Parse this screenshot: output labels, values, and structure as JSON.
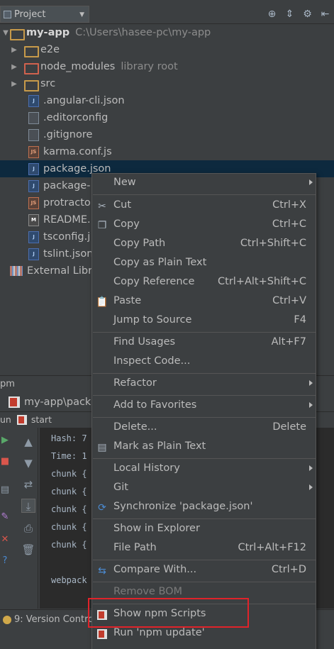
{
  "project_bar": {
    "selector_label": "Project",
    "toolbar_icons": [
      "target-icon",
      "collapse-icon",
      "gear-icon",
      "hide-icon"
    ]
  },
  "tree": {
    "root": {
      "name": "my-app",
      "path": "C:\\Users\\hasee-pc\\my-app"
    },
    "items": [
      {
        "name": "e2e",
        "kind": "folder"
      },
      {
        "name": "node_modules",
        "kind": "folder",
        "suffix": "library root"
      },
      {
        "name": "src",
        "kind": "folder"
      },
      {
        "name": ".angular-cli.json",
        "kind": "json"
      },
      {
        "name": ".editorconfig",
        "kind": "plain"
      },
      {
        "name": ".gitignore",
        "kind": "plain"
      },
      {
        "name": "karma.conf.js",
        "kind": "js"
      },
      {
        "name": "package.json",
        "kind": "json",
        "selected": true
      },
      {
        "name": "package-",
        "kind": "json"
      },
      {
        "name": "protracto",
        "kind": "js"
      },
      {
        "name": "README.",
        "kind": "md"
      },
      {
        "name": "tsconfig.j",
        "kind": "json"
      },
      {
        "name": "tslint.json",
        "kind": "json"
      }
    ],
    "external": "External Libra"
  },
  "npm_panel": {
    "title": "pm",
    "item": "my-app\\pack",
    "run_label": "un",
    "run_config": "start"
  },
  "console": {
    "lines": [
      "Hash: 7",
      "Time: 1",
      "chunk {",
      "chunk {",
      "chunk {",
      "chunk {",
      "chunk {",
      "",
      "webpack"
    ]
  },
  "status_bar": {
    "version_control": "9: Version Contro"
  },
  "context_menu": {
    "items": [
      {
        "label": "New",
        "submenu": true
      },
      {
        "label": "Cut",
        "shortcut": "Ctrl+X",
        "icon": "scissors-icon"
      },
      {
        "label": "Copy",
        "shortcut": "Ctrl+C",
        "icon": "copy-icon"
      },
      {
        "label": "Copy Path",
        "shortcut": "Ctrl+Shift+C"
      },
      {
        "label": "Copy as Plain Text"
      },
      {
        "label": "Copy Reference",
        "shortcut": "Ctrl+Alt+Shift+C"
      },
      {
        "label": "Paste",
        "shortcut": "Ctrl+V",
        "icon": "paste-icon"
      },
      {
        "label": "Jump to Source",
        "shortcut": "F4"
      },
      {
        "label": "Find Usages",
        "shortcut": "Alt+F7"
      },
      {
        "label": "Inspect Code..."
      },
      {
        "label": "Refactor",
        "submenu": true
      },
      {
        "label": "Add to Favorites",
        "submenu": true
      },
      {
        "label": "Delete...",
        "shortcut": "Delete"
      },
      {
        "label": "Mark as Plain Text",
        "icon": "plain-text-icon"
      },
      {
        "label": "Local History",
        "submenu": true
      },
      {
        "label": "Git",
        "submenu": true
      },
      {
        "label": "Synchronize 'package.json'",
        "icon": "sync-icon"
      },
      {
        "label": "Show in Explorer"
      },
      {
        "label": "File Path",
        "shortcut": "Ctrl+Alt+F12"
      },
      {
        "label": "Compare With...",
        "shortcut": "Ctrl+D",
        "icon": "compare-icon"
      },
      {
        "label": "Remove BOM",
        "disabled": true
      },
      {
        "label": "Show npm Scripts",
        "icon": "npm-icon"
      },
      {
        "label": "Run 'npm update'",
        "icon": "npm-icon"
      }
    ]
  },
  "colors": {
    "background": "#3c3f41",
    "selection": "#0d293e",
    "highlight_box": "#e0232a"
  }
}
